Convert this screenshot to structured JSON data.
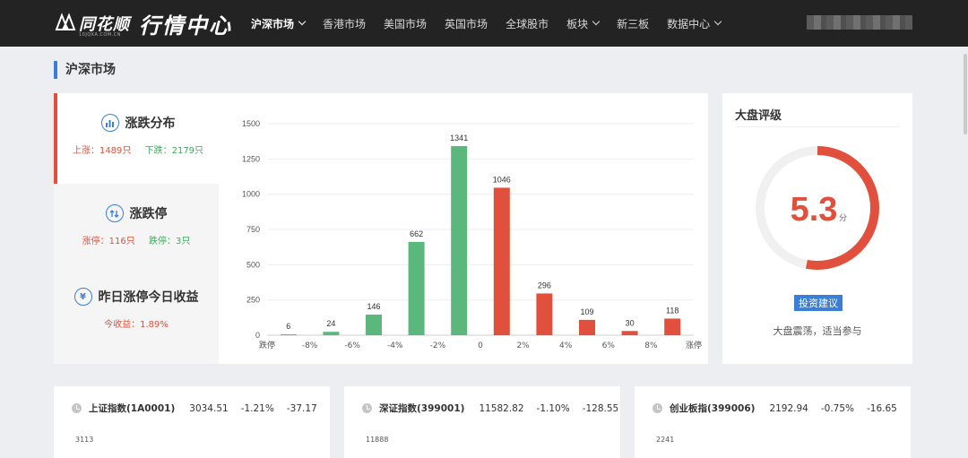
{
  "header": {
    "brand": "同花顺",
    "brand_sub": "10JQKA.COM.CN",
    "title": "行情中心",
    "nav": [
      {
        "label": "沪深市场",
        "dropdown": true,
        "active": true
      },
      {
        "label": "香港市场",
        "dropdown": false
      },
      {
        "label": "美国市场",
        "dropdown": false
      },
      {
        "label": "英国市场",
        "dropdown": false
      },
      {
        "label": "全球股市",
        "dropdown": false
      },
      {
        "label": "板块",
        "dropdown": true
      },
      {
        "label": "新三板",
        "dropdown": false
      },
      {
        "label": "数据中心",
        "dropdown": true
      }
    ]
  },
  "section_title": "沪深市场",
  "left_panel": {
    "items": [
      {
        "icon": "bar-chart-icon",
        "title": "涨跌分布",
        "sub_a": "上涨：1489只",
        "sub_b": "下跌：2179只"
      },
      {
        "icon": "swap-arrows-icon",
        "title": "涨跌停",
        "sub_a": "涨停：116只",
        "sub_b": "跌停：3只"
      },
      {
        "icon": "yen-icon",
        "title": "昨日涨停今日收益",
        "sub_a": "今收益：1.89%",
        "sub_b": ""
      }
    ]
  },
  "chart_data": {
    "type": "bar",
    "categories": [
      "跌停",
      "-8%",
      "-6%",
      "-4%",
      "-2%",
      "0",
      "2%",
      "4%",
      "6%",
      "8%",
      "涨停"
    ],
    "values": [
      6,
      24,
      146,
      662,
      1341,
      1046,
      296,
      109,
      30,
      118
    ],
    "colors": [
      "#5bb77c",
      "#5bb77c",
      "#5bb77c",
      "#5bb77c",
      "#5bb77c",
      "#e1503c",
      "#e1503c",
      "#e1503c",
      "#e1503c",
      "#e1503c"
    ],
    "ylim": [
      0,
      1500
    ],
    "yticks": [
      0,
      250,
      500,
      750,
      1000,
      1250,
      1500
    ],
    "grid": true
  },
  "rating": {
    "title": "大盘评级",
    "score": "5.3",
    "unit": "分",
    "score_fraction": 0.53,
    "ring_color": "#e1503c",
    "track_color": "#f0f0f0",
    "badge": "投资建议",
    "description": "大盘震荡，适当参与"
  },
  "indices": [
    {
      "name": "上证指数(1A0001)",
      "value": "3034.51",
      "pct": "-1.21%",
      "change": "-37.17",
      "small": "3113"
    },
    {
      "name": "深证指数(399001)",
      "value": "11582.82",
      "pct": "-1.10%",
      "change": "-128.55",
      "small": "11888"
    },
    {
      "name": "创业板指(399006)",
      "value": "2192.94",
      "pct": "-0.75%",
      "change": "-16.65",
      "small": "2241"
    }
  ],
  "colors": {
    "up": "#e1503c",
    "down": "#3eaa5a",
    "accent": "#3a7fd5",
    "topbar": "#232323"
  }
}
